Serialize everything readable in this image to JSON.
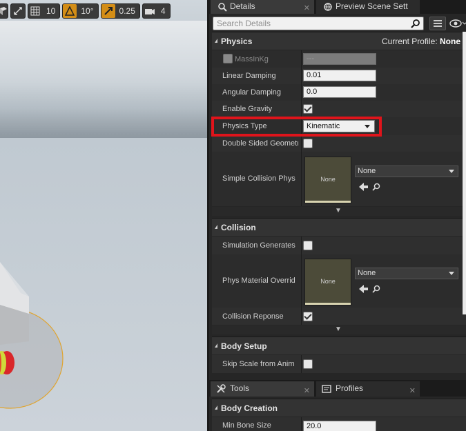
{
  "viewport_toolbar": {
    "grid_snap": "10",
    "rotation_snap": "10°",
    "scale_snap": "0.25",
    "camera_speed": "4"
  },
  "tabs": [
    {
      "label": "Details",
      "icon": "details-icon"
    },
    {
      "label": "Preview Scene Sett",
      "icon": "preview-scene-icon"
    }
  ],
  "search": {
    "placeholder": "Search Details"
  },
  "physics": {
    "title": "Physics",
    "profile_label": "Current Profile:",
    "profile_value": "None",
    "rows": {
      "mass": {
        "label": "MassInKg",
        "value": "---"
      },
      "linear_damping": {
        "label": "Linear Damping",
        "value": "0.01"
      },
      "angular_damping": {
        "label": "Angular Damping",
        "value": "0.0"
      },
      "enable_gravity": {
        "label": "Enable Gravity",
        "checked": true
      },
      "physics_type": {
        "label": "Physics Type",
        "value": "Kinematic"
      },
      "double_sided": {
        "label": "Double Sided Geometr",
        "checked": false
      },
      "simple_collision": {
        "label": "Simple Collision Phys",
        "thumb": "None",
        "asset": "None"
      }
    }
  },
  "collision": {
    "title": "Collision",
    "rows": {
      "sim_generates_hit": {
        "label": "Simulation Generates",
        "checked": false
      },
      "phys_material_override": {
        "label": "Phys Material Overrid",
        "thumb": "None",
        "asset": "None"
      },
      "collision_response": {
        "label": "Collision Reponse",
        "checked": true
      }
    }
  },
  "body_setup": {
    "title": "Body Setup",
    "rows": {
      "skip_scale": {
        "label": "Skip Scale from Anim",
        "checked": false
      }
    }
  },
  "bottom_tabs": [
    {
      "label": "Tools",
      "icon": "tools-icon"
    },
    {
      "label": "Profiles",
      "icon": "profiles-icon"
    }
  ],
  "body_creation": {
    "title": "Body Creation",
    "min_bone_size": {
      "label": "Min Bone Size",
      "value": "20.0"
    }
  },
  "colors": {
    "highlight": "#e0141b",
    "thumb": "#4c4b39",
    "accent": "#d38d16"
  }
}
